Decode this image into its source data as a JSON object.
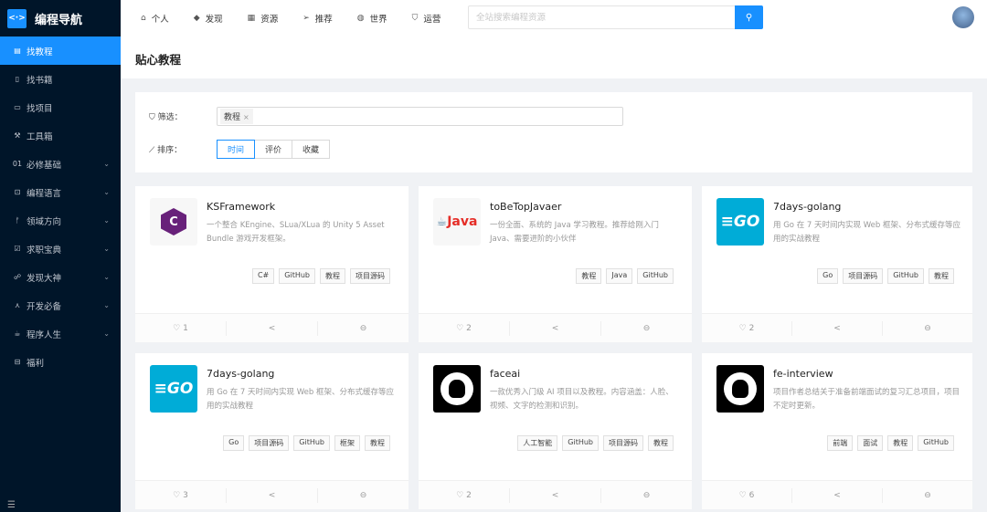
{
  "app": {
    "title": "编程导航",
    "logo_mark": "<·>"
  },
  "sidebar": {
    "items": [
      {
        "label": "找教程",
        "icon": "book-icon",
        "glyph": "▤",
        "active": true
      },
      {
        "label": "找书籍",
        "icon": "file-icon",
        "glyph": "▯"
      },
      {
        "label": "找项目",
        "icon": "laptop-icon",
        "glyph": "▭"
      },
      {
        "label": "工具箱",
        "icon": "tool-icon",
        "glyph": "⚒"
      },
      {
        "label": "必修基础",
        "icon": "number-icon",
        "glyph": "01",
        "chevron": true
      },
      {
        "label": "编程语言",
        "icon": "code-icon",
        "glyph": "⊡",
        "chevron": true
      },
      {
        "label": "领域方向",
        "icon": "branch-icon",
        "glyph": "ᚠ",
        "chevron": true
      },
      {
        "label": "求职宝典",
        "icon": "calendar-check-icon",
        "glyph": "☑",
        "chevron": true
      },
      {
        "label": "发现大神",
        "icon": "users-icon",
        "glyph": "☍",
        "chevron": true
      },
      {
        "label": "开发必备",
        "icon": "deployment-icon",
        "glyph": "⋏",
        "chevron": true
      },
      {
        "label": "程序人生",
        "icon": "coffee-icon",
        "glyph": "☕",
        "chevron": true
      },
      {
        "label": "福利",
        "icon": "gift-icon",
        "glyph": "⊟"
      }
    ],
    "collapse_glyph": "☰"
  },
  "topnav": [
    {
      "label": "个人",
      "icon": "home-icon",
      "glyph": "⌂"
    },
    {
      "label": "发现",
      "icon": "diamond-icon",
      "glyph": "◆"
    },
    {
      "label": "资源",
      "icon": "grid-icon",
      "glyph": "▦"
    },
    {
      "label": "推荐",
      "icon": "send-icon",
      "glyph": "➢"
    },
    {
      "label": "世界",
      "icon": "globe-icon",
      "glyph": "◍"
    },
    {
      "label": "运营",
      "icon": "shield-icon",
      "glyph": "⛉"
    }
  ],
  "search": {
    "placeholder": "全站搜索编程资源",
    "value": "",
    "button_glyph": "⚲"
  },
  "page": {
    "title": "贴心教程"
  },
  "filter": {
    "label": "筛选：",
    "tags": [
      "教程"
    ],
    "sort_label": "排序：",
    "sort_options": [
      "时间",
      "评价",
      "收藏"
    ],
    "sort_selected": "时间"
  },
  "colors": {
    "primary": "#1890ff",
    "sidebar": "#001529"
  },
  "cards": [
    {
      "title": "KSFramework",
      "desc": "一个整合 KEngine、SLua/XLua 的 Unity 5 Asset Bundle 游戏开发框架。",
      "tags": [
        "C#",
        "GitHub",
        "教程",
        "项目源码"
      ],
      "likes": "1",
      "logo": "C#"
    },
    {
      "title": "toBeTopJavaer",
      "desc": "一份全面、系统的 Java 学习教程。推荐给刚入门 Java、需要进阶的小伙伴",
      "tags": [
        "教程",
        "Java",
        "GitHub"
      ],
      "likes": "2",
      "logo": "Java"
    },
    {
      "title": "7days-golang",
      "desc": "用 Go 在 7 天时间内实现 Web 框架、分布式缓存等应用的实战教程",
      "tags": [
        "Go",
        "项目源码",
        "GitHub",
        "教程"
      ],
      "likes": "2",
      "logo": "GO"
    },
    {
      "title": "7days-golang",
      "desc": "用 Go 在 7 天时间内实现 Web 框架、分布式缓存等应用的实战教程",
      "tags": [
        "Go",
        "项目源码",
        "GitHub",
        "框架",
        "教程"
      ],
      "likes": "3",
      "logo": "GO"
    },
    {
      "title": "faceai",
      "desc": "一款优秀入门级 AI 项目以及教程。内容涵盖：人脸、视频、文字的检测和识别。",
      "tags": [
        "人工智能",
        "GitHub",
        "项目源码",
        "教程"
      ],
      "likes": "2",
      "logo": "GitHub"
    },
    {
      "title": "fe-interview",
      "desc": "项目作者总结关于准备前端面试的复习汇总项目，项目不定时更新。",
      "tags": [
        "前端",
        "面试",
        "教程",
        "GitHub"
      ],
      "likes": "6",
      "logo": "GitHub"
    }
  ]
}
